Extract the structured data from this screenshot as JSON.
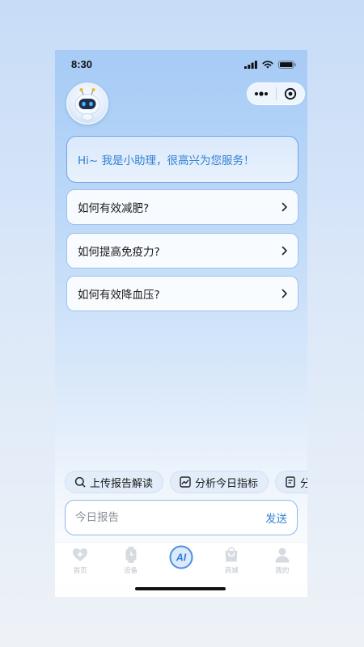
{
  "status_bar": {
    "time": "8:30"
  },
  "assistant": {
    "greeting": "Hi~ 我是小助理，很高兴为您服务！",
    "questions": [
      {
        "label": "如何有效减肥?"
      },
      {
        "label": "如何提高免疫力?"
      },
      {
        "label": "如何有效降血压?"
      }
    ]
  },
  "quick_actions": [
    {
      "label": "上传报告解读",
      "icon": "search-icon"
    },
    {
      "label": "分析今日指标",
      "icon": "chart-icon"
    },
    {
      "label": "分",
      "icon": "document-icon"
    }
  ],
  "composer": {
    "placeholder": "今日报告",
    "send_label": "发送"
  },
  "tabbar": {
    "items": [
      {
        "label": "首页",
        "icon": "home-heart-icon"
      },
      {
        "label": "设备",
        "icon": "watch-icon"
      },
      {
        "label": "AI",
        "icon": "ai-icon"
      },
      {
        "label": "商城",
        "icon": "shopping-bag-icon"
      },
      {
        "label": "我的",
        "icon": "user-icon"
      }
    ]
  },
  "colors": {
    "accent": "#3a86d8",
    "greeting_text": "#2f7fd6",
    "tab_inactive": "#bdc3ca"
  }
}
